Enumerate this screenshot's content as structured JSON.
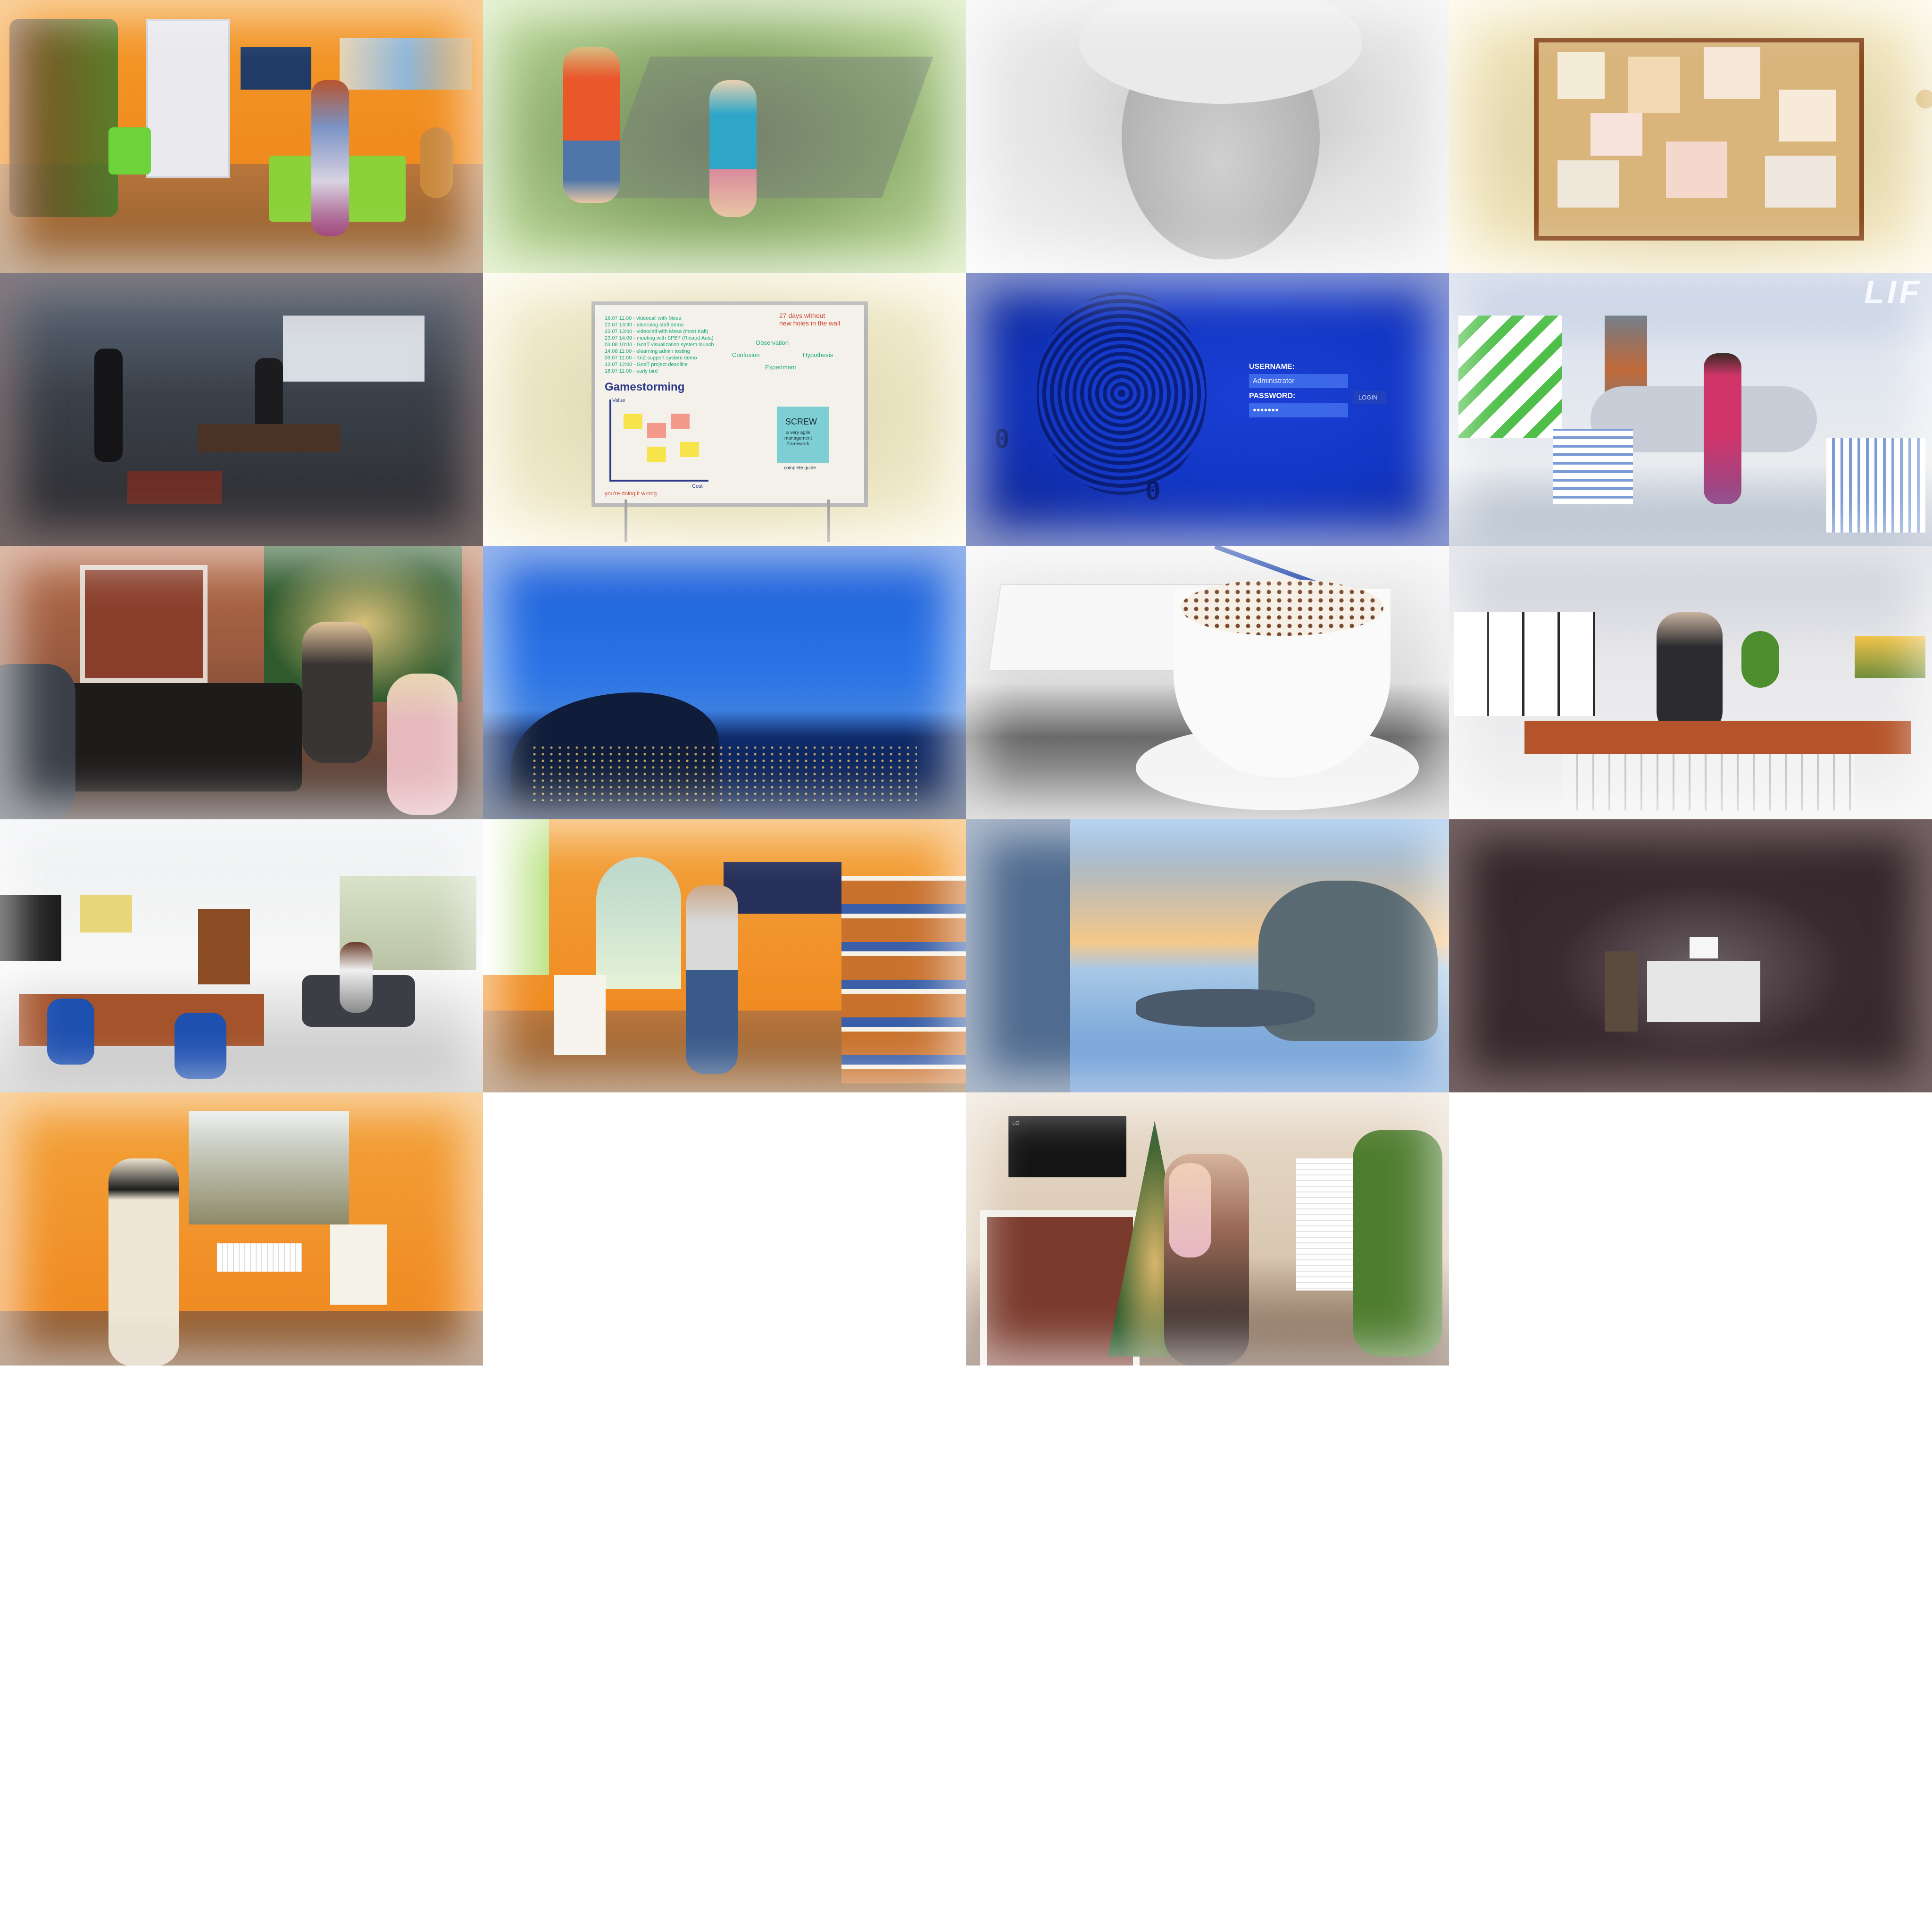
{
  "gallery": {
    "columns": 4,
    "tiles": [
      {
        "scene": "orange bedroom with woman avatar sitting on green bed, tree bookshelf, guitar"
      },
      {
        "scene": "two toddlers walking on garden path"
      },
      {
        "scene": "black and white close-up of young girl looking down"
      },
      {
        "scene": "cork board with children's drawings"
      },
      {
        "scene": "dark open office workshop with people"
      },
      {
        "scene": "whiteboard gamestorming notes"
      },
      {
        "scene": "blue fingerprint login screen"
      },
      {
        "scene": "futuristic white lounge with female avatar"
      },
      {
        "scene": "children by christmas tree and fireplace"
      },
      {
        "scene": "coastal town at dusk"
      },
      {
        "scene": "cappuccino cup next to open notebook"
      },
      {
        "scene": "office desk with male avatar"
      },
      {
        "scene": "office room with desks, couch and seated avatar"
      },
      {
        "scene": "orange room with male avatar and bookshelf"
      },
      {
        "scene": "rocky seashore at sunset"
      },
      {
        "scene": "dim spotlit desk and chair"
      },
      {
        "scene": "orange room with avatar in white coat and hat"
      },
      {
        "scene": "empty"
      },
      {
        "scene": "grandfather holding baby by christmas tree"
      },
      {
        "scene": "empty"
      }
    ]
  },
  "whiteboard": {
    "counter": "27 days without\nnew holes in the wall",
    "title": "Gamestorming",
    "log_lines": [
      "16.07 11:00 - videocall with Mesa",
      "22.07 13:30 - elearning staff demo",
      "23.07 13:00 - videocall with Mesa (most Kalt)",
      "23.07 14:00 - meeting with SPB7 (Rinaud Aula)",
      "03.08 10:00 - GoaT visualization system launch",
      "14.08 11:00 - elearning admin testing",
      "05.07 11:00 - KnZ support system demo",
      "13.07 12:00 - GoaT project deadline",
      "18.07 11:00 - early bird"
    ],
    "cycle": [
      "Observation",
      "Confusion",
      "Hypothesis",
      "Experiment"
    ],
    "axis_y": "Value",
    "axis_x": "Cost",
    "footer_note": "you're doing it wrong",
    "screw_title": "SCREW",
    "screw_subtitle": "a very agile\nmanagement\nframework",
    "screw_footer": "complete guide"
  },
  "login": {
    "username_label": "USERNAME:",
    "username_value": "Administrator",
    "password_label": "PASSWORD:",
    "password_value": "●●●●●●●",
    "login_button": "LOGIN"
  },
  "lounge": {
    "wall_text": "LIF"
  },
  "tv": {
    "brand": "LG"
  },
  "colors": {
    "background": "#ffffff",
    "orange_wall": "#f29a2e",
    "login_blue": "#1a3fd6",
    "whiteboard_green": "#2bbf8a"
  }
}
